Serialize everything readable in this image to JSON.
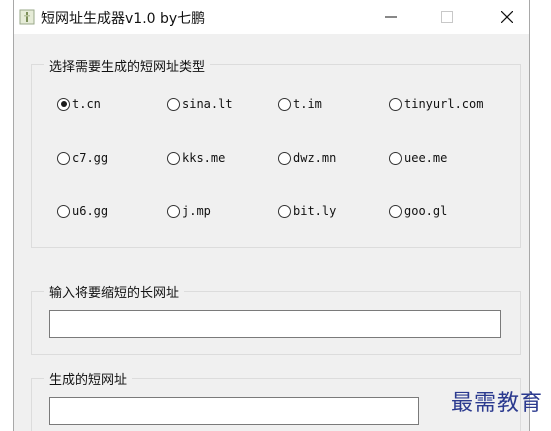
{
  "window": {
    "title": "短网址生成器v1.0   by七鹏",
    "controls": {
      "minimize": "—",
      "maximize": "☐",
      "close": "✕"
    }
  },
  "type_group": {
    "legend": "选择需要生成的短网址类型",
    "options": [
      {
        "label": "t.cn",
        "selected": true
      },
      {
        "label": "sina.lt",
        "selected": false
      },
      {
        "label": "t.im",
        "selected": false
      },
      {
        "label": "tinyurl.com",
        "selected": false
      },
      {
        "label": "c7.gg",
        "selected": false
      },
      {
        "label": "kks.me",
        "selected": false
      },
      {
        "label": "dwz.mn",
        "selected": false
      },
      {
        "label": "uee.me",
        "selected": false
      },
      {
        "label": "u6.gg",
        "selected": false
      },
      {
        "label": "j.mp",
        "selected": false
      },
      {
        "label": "bit.ly",
        "selected": false
      },
      {
        "label": "goo.gl",
        "selected": false
      }
    ]
  },
  "long_url_group": {
    "legend": "输入将要缩短的长网址",
    "value": ""
  },
  "short_url_group": {
    "legend": "生成的短网址",
    "value": ""
  },
  "watermark": "最需教育"
}
